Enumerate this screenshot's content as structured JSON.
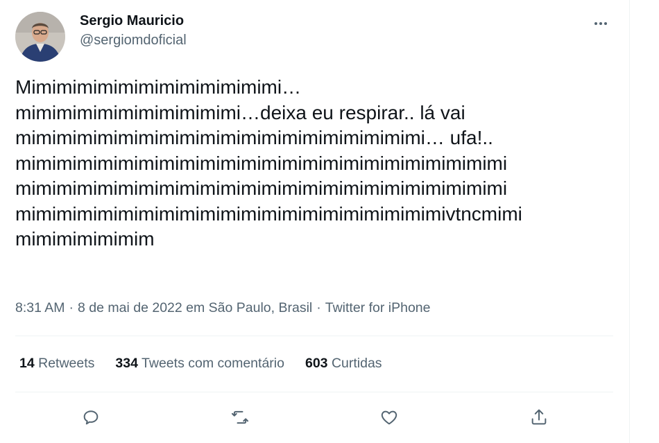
{
  "user": {
    "display_name": "Sergio Mauricio",
    "handle": "@sergiomdoficial"
  },
  "tweet": {
    "text": "Mimimimimimimimimimimimimi…\nmimimimimimimimimimimi…deixa eu respirar.. lá vai\nmimimimimimimimimimimimimimimimimimimimi… ufa!..\nmimimimimimimimimimimimimimimimimimimimimimimimi\nmimimimimimimimimimimimimimimimimimimimimimimimi\nmimimimimimimimimimimimimimimimimimimimimivtncmimi\nmimimimimimim"
  },
  "meta": {
    "time": "8:31 AM",
    "separator": "·",
    "date_location": "8 de mai de 2022 em São Paulo, Brasil",
    "source": "Twitter for iPhone"
  },
  "stats": {
    "retweets_count": "14",
    "retweets_label": "Retweets",
    "quotes_count": "334",
    "quotes_label": "Tweets com comentário",
    "likes_count": "603",
    "likes_label": "Curtidas"
  },
  "actions": {
    "reply_icon": "reply-icon",
    "retweet_icon": "retweet-icon",
    "like_icon": "heart-icon",
    "share_icon": "share-icon",
    "more_icon": "more-icon"
  },
  "colors": {
    "text_primary": "#0f1419",
    "text_secondary": "#536471",
    "divider": "#eff3f4"
  }
}
